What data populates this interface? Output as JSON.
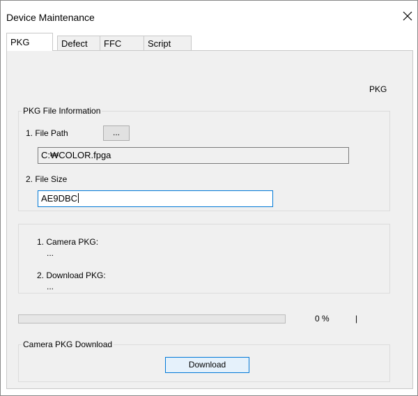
{
  "window": {
    "title": "Device Maintenance"
  },
  "tabs": [
    {
      "label": "PKG",
      "active": true
    },
    {
      "label": "Defect",
      "active": false
    },
    {
      "label": "FFC",
      "active": false
    },
    {
      "label": "Script",
      "active": false
    }
  ],
  "panel": {
    "heading": "PKG",
    "file_info": {
      "group_label": "PKG File Information",
      "file_path_label": "1. File Path",
      "browse_label": "...",
      "file_path_value": "C:₩COLOR.fpga",
      "file_size_label": "2. File Size",
      "file_size_value": "AE9DBC"
    },
    "versions": {
      "camera_pkg_label": "1. Camera PKG:",
      "camera_pkg_value": "...",
      "download_pkg_label": "2. Download PKG:",
      "download_pkg_value": "..."
    },
    "progress": {
      "percent_text": "0 %",
      "value": 0,
      "separator": "|"
    },
    "download": {
      "group_label": "Camera PKG Download",
      "button_label": "Download"
    }
  },
  "colors": {
    "accent": "#0078d7",
    "panel_bg": "#f0f0f0"
  }
}
